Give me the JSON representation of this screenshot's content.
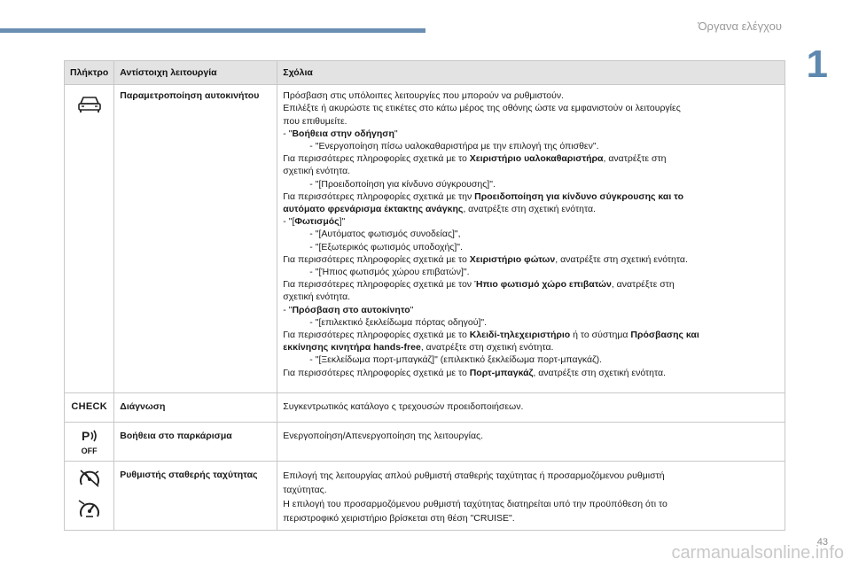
{
  "header": {
    "section_title": "Όργανα ελέγχου",
    "chapter_number": "1"
  },
  "table": {
    "col_key": "Πλήκτρο",
    "col_function": "Αντίστοιχη λειτουργία",
    "col_comments": "Σχόλια",
    "row_vehicle": {
      "function": "Παραμετροποίηση αυτοκινήτου",
      "icon": "car-icon",
      "l1": "Πρόσβαση στις υπόλοιπες λειτουργίες που μπορούν να ρυθμιστούν.",
      "l2": "Επιλέξτε ή ακυρώστε τις ετικέτες στο κάτω μέρος της οθόνης ώστε να εμφανιστούν οι λειτουργίες",
      "l3": "που επιθυμείτε.",
      "l4_pre": "- \"",
      "l4_bold": "Βοήθεια στην οδήγηση",
      "l4_post": "\"",
      "l5": "- \"Ενεργοποίηση πίσω υαλοκαθαριστήρα με την επιλογή της όπισθεν\".",
      "l6_pre": "Για περισσότερες πληροφορίες σχετικά με το ",
      "l6_bold": "Χειριστήριο υαλοκαθαριστήρα",
      "l6_post": ", ανατρέξτε στη",
      "l7": "σχετική ενότητα.",
      "l8": "- \"[Προειδοποίηση για κίνδυνο σύγκρουσης]\".",
      "l9_pre": "Για περισσότερες πληροφορίες σχετικά με την ",
      "l9_bold": "Προειδοποίηση για κίνδυνο σύγκρουσης και το",
      "l10_bold": "αυτόματο φρενάρισμα έκτακτης ανάγκης",
      "l10_post": ", ανατρέξτε στη σχετική ενότητα.",
      "l11_pre": "- \"[",
      "l11_bold": "Φωτισμός",
      "l11_post": "]\"",
      "l12": "- \"[Αυτόματος φωτισμός συνοδείας]\",",
      "l13": "- \"[Εξωτερικός φωτισμός υποδοχής]\".",
      "l14_pre": "Για περισσότερες πληροφορίες σχετικά με το ",
      "l14_bold": "Χειριστήριο φώτων",
      "l14_post": ", ανατρέξτε στη σχετική ενότητα.",
      "l15": "- \"[Ήπιος φωτισμός χώρου επιβατών]\".",
      "l16_pre": "Για περισσότερες πληροφορίες σχετικά με τον ",
      "l16_bold": "Ήπιο φωτισμό χώρο επιβατών",
      "l16_post": ", ανατρέξτε στη",
      "l17": "σχετική ενότητα.",
      "l18_pre": "- \"",
      "l18_bold": "Πρόσβαση στο αυτοκίνητο",
      "l18_post": "\"",
      "l19": "- \"[επιλεκτικό ξεκλείδωμα πόρτας οδηγού]\".",
      "l20_pre": "Για περισσότερες πληροφορίες σχετικά με το ",
      "l20_bold": "Κλειδί-τηλεχειριστήριο",
      "l20_mid": " ή το σύστημα ",
      "l20_bold2": "Πρόσβασης και",
      "l21_bold": "εκκίνησης κινητήρα hands-free",
      "l21_post": ", ανατρέξτε στη σχετική ενότητα.",
      "l22": "- \"[Ξεκλείδωμα πορτ-μπαγκάζ]\" (επιλεκτικό ξεκλείδωμα πορτ-μπαγκάζ).",
      "l23_pre": "Για περισσότερες πληροφορίες σχετικά με το ",
      "l23_bold": "Πορτ-μπαγκάζ",
      "l23_post": ", ανατρέξτε στη σχετική ενότητα."
    },
    "row_check": {
      "key_label": "CHECK",
      "function": "Διάγνωση",
      "comment": "Συγκεντρωτικός κατάλογο ς τρεχουσών προειδοποιήσεων."
    },
    "row_park": {
      "off_label": "OFF",
      "icon": "park-assist-off-icon",
      "function": "Βοήθεια στο παρκάρισμα",
      "comment": "Ενεργοποίηση/Απενεργοποίηση της λειτουργίας."
    },
    "row_speed": {
      "icon1": "cruise-control-icon",
      "icon2": "speed-limiter-icon",
      "function": "Ρυθμιστής σταθερής ταχύτητας",
      "l1": "Επιλογή της λειτουργίας απλού ρυθμιστή σταθερής ταχύτητας ή προσαρμοζόμενου ρυθμιστή",
      "l2": "ταχύτητας.",
      "l3": "Η επιλογή του προσαρμοζόμενου ρυθμιστή ταχύτητας διατηρείται υπό την προϋπόθεση ότι το",
      "l4": "περιστροφικό χειριστήριο βρίσκεται στη θέση \"CRUISE\"."
    }
  },
  "footer": {
    "page_number": "43",
    "watermark": "carmanualsonline.info"
  }
}
